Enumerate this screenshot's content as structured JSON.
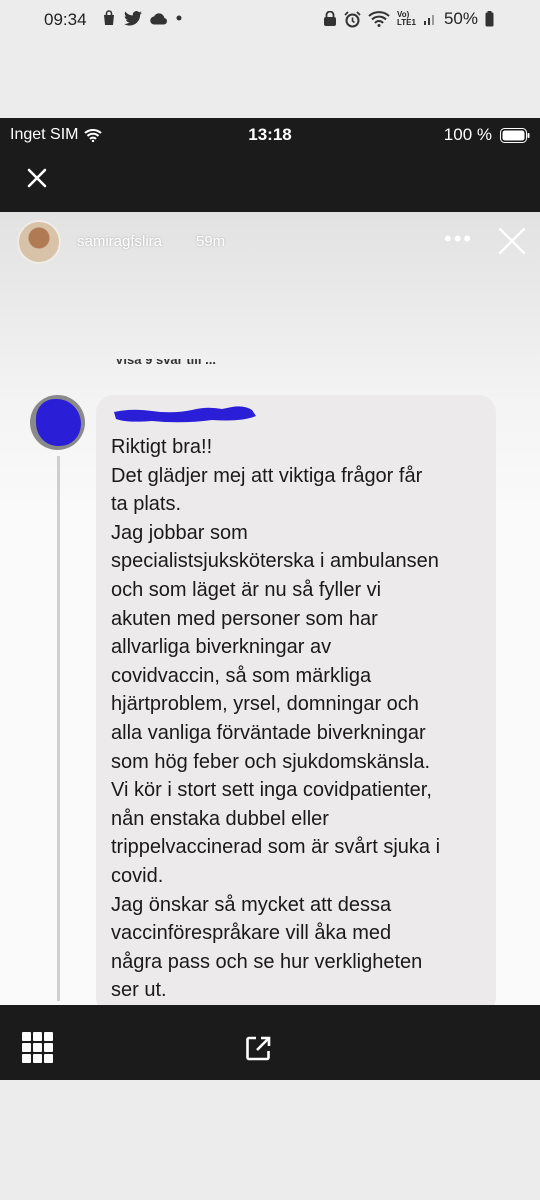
{
  "android_status": {
    "time": "09:34",
    "battery_percent": "50%",
    "lte_label_top": "Vo)",
    "lte_label_bottom": "LTE1"
  },
  "ios_status": {
    "carrier": "Inget SIM",
    "time": "13:18",
    "battery": "100 %"
  },
  "story": {
    "username": "samiragfslira",
    "time_ago": "59m",
    "more_label": "•••"
  },
  "post": {
    "truncated_header": "Visa 9 svar till ..."
  },
  "comment": {
    "lines": [
      "Riktigt bra!!",
      "Det glädjer mej att viktiga frågor får",
      "ta plats.",
      "Jag jobbar som",
      "specialistsjuksköterska i ambulansen",
      "och som läget är nu så fyller vi",
      "akuten med personer som har",
      "allvarliga biverkningar av",
      "covidvaccin, så som märkliga",
      "hjärtproblem, yrsel, domningar och",
      "alla vanliga förväntade biverkningar",
      "som hög feber och sjukdomskänsla.",
      "Vi kör i stort sett inga covidpatienter,",
      "nån enstaka dubbel eller",
      "trippelvaccinerad som är svårt sjuka i",
      "covid.",
      "Jag önskar så mycket att dessa",
      "vaccinförespråkare vill åka med",
      "några pass och se hur verkligheten",
      "ser ut."
    ]
  },
  "colors": {
    "redaction": "#2a1fd6",
    "dark_bar": "#1b1b1b",
    "bubble": "#eceaea"
  },
  "icons": {
    "close": "close-icon",
    "grid": "grid-icon",
    "share": "share-icon"
  }
}
